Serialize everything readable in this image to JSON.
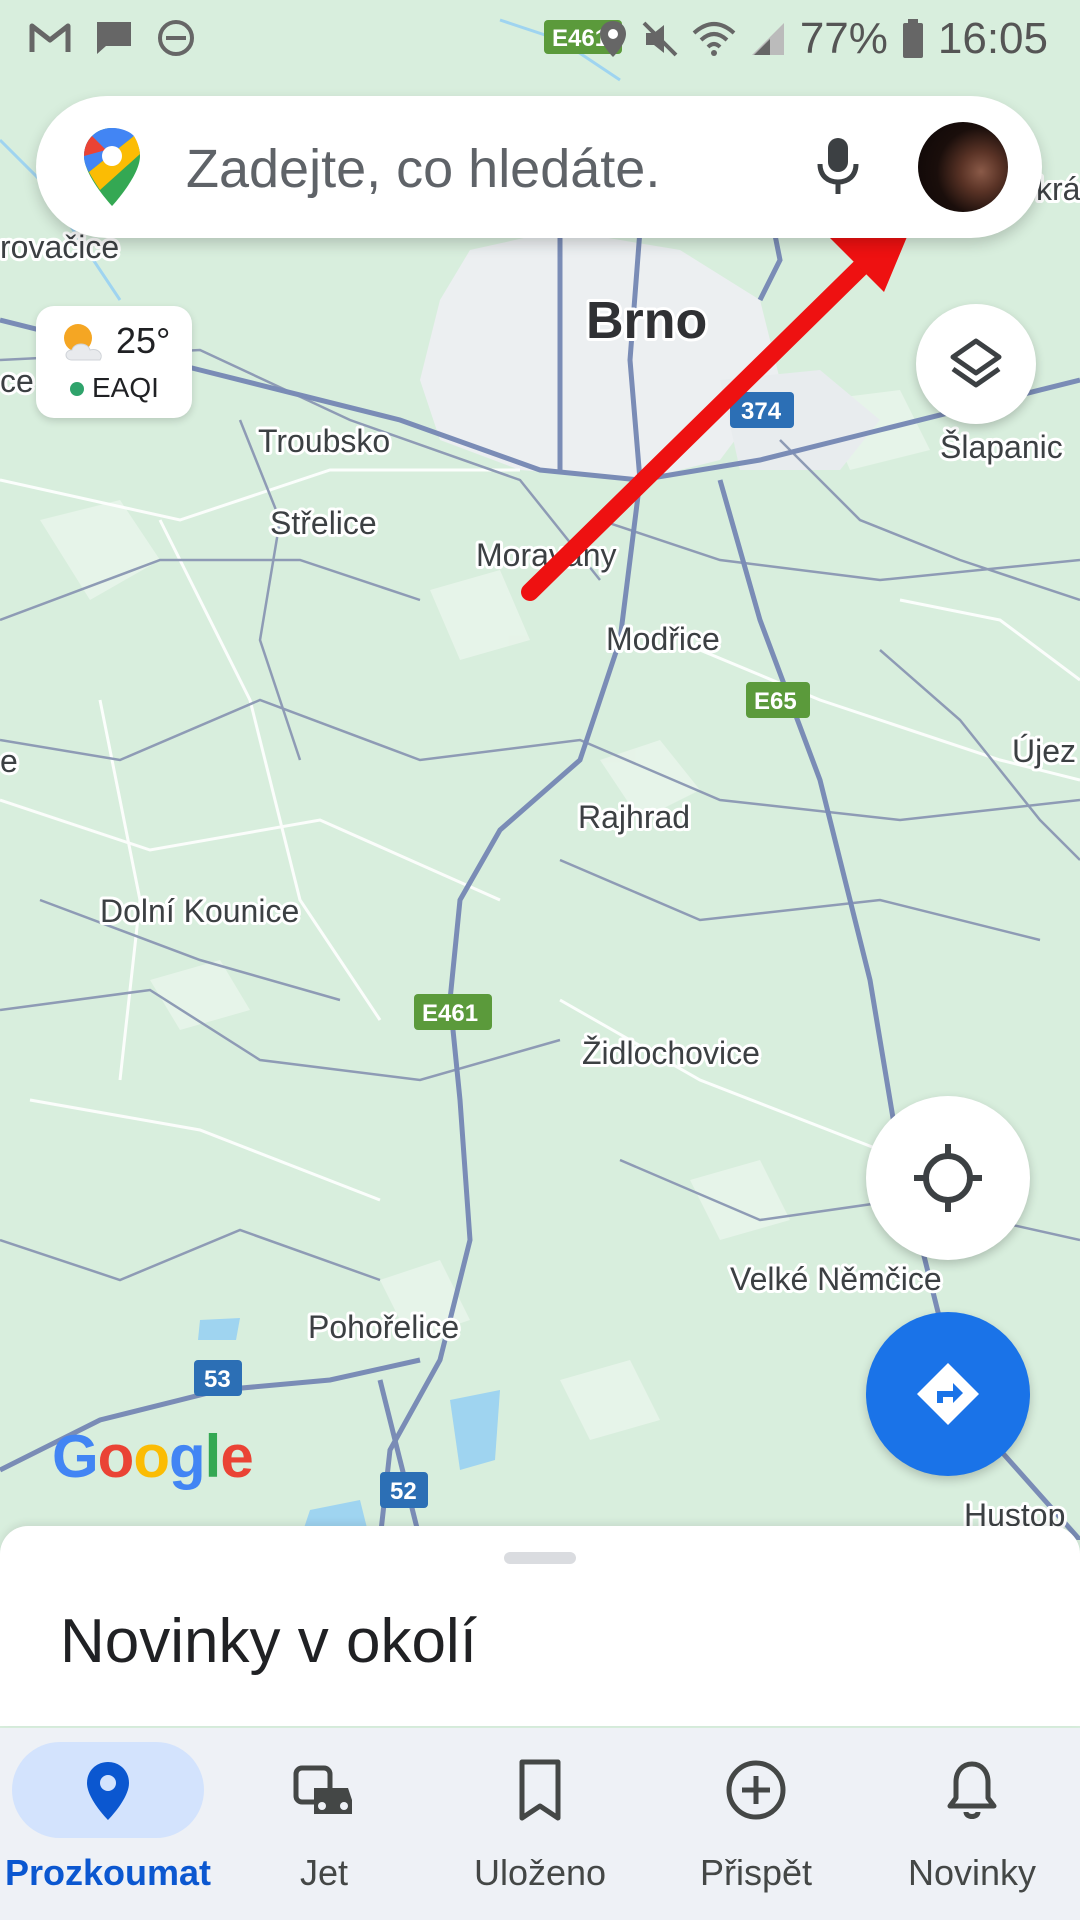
{
  "status_bar": {
    "battery": "77%",
    "time": "16:05"
  },
  "search": {
    "placeholder": "Zadejte, co hledáte."
  },
  "weather": {
    "temperature": "25°",
    "air_quality_label": "EAQI"
  },
  "map": {
    "places": [
      "Brno",
      "Troubsko",
      "Střelice",
      "Moravany",
      "Modřice",
      "Šlapanice",
      "Rajhrad",
      "Dolní Kounice",
      "Židlochovice",
      "Velké Němčice",
      "Pohořelice",
      "Hustop",
      "Újez",
      "rovačice",
      "krá-",
      "ce",
      "e"
    ],
    "road_shields": [
      "E461",
      "374",
      "E65",
      "E461",
      "53",
      "52"
    ],
    "attribution": [
      "G",
      "o",
      "o",
      "g",
      "l",
      "e"
    ]
  },
  "sheet": {
    "title": "Novinky v okolí"
  },
  "nav": {
    "items": [
      {
        "label": "Prozkoumat",
        "icon": "location-pin-icon",
        "active": true
      },
      {
        "label": "Jet",
        "icon": "commute-icon",
        "active": false
      },
      {
        "label": "Uloženo",
        "icon": "bookmark-icon",
        "active": false
      },
      {
        "label": "Přispět",
        "icon": "add-circle-icon",
        "active": false
      },
      {
        "label": "Novinky",
        "icon": "bell-icon",
        "active": false
      }
    ]
  },
  "colors": {
    "accent": "#1a73e8",
    "active_nav": "#0b57d0",
    "map_land": "#d8eedd",
    "road_shield_green": "#5b9a3b",
    "road_shield_blue": "#2c6fb5",
    "annotation_arrow": "#ee1111"
  }
}
